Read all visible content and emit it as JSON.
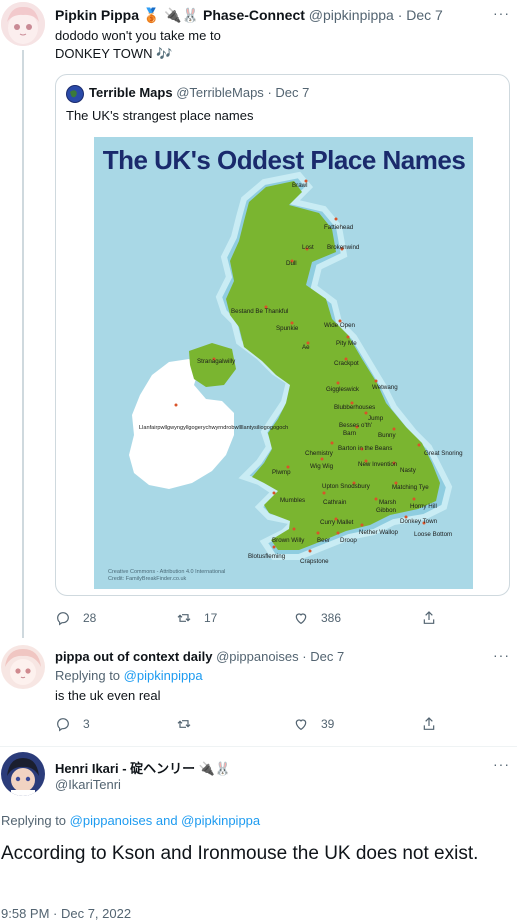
{
  "tweet1": {
    "name": "Pipkin Pippa",
    "name_suffix": "🥉 🔌🐰 Phase-Connect",
    "handle": "@pipkinpippa",
    "date": "· Dec 7",
    "text_line1": "dododo won't you take me to",
    "text_line2": "DONKEY TOWN 🎶",
    "replies": "28",
    "retweets": "17",
    "likes": "386"
  },
  "quote": {
    "name": "Terrible Maps",
    "handle": "@TerribleMaps",
    "date": "· Dec 7",
    "text": "The UK's strangest place names",
    "map_title": "The UK's Oddest Place Names",
    "credit_line1": "Creative Commons - Attribution 4.0 International",
    "credit_line2": "Credit: FamilyBreakFinder.co.uk",
    "places": {
      "brawl": "Brawl",
      "fattiehead": "Fattiehead",
      "lost": "Lost",
      "brokenwind": "Brokenwind",
      "dull": "Dull",
      "bestand": "Bestand Be Thankful",
      "spunkie": "Spunkie",
      "wideopen": "Wide Open",
      "pityme": "Pity Me",
      "ae": "Ae",
      "crackpot": "Crackpot",
      "stranagalwilly": "Stranagalwilly",
      "giggleswick": "Giggleswick",
      "wetwang": "Wetwang",
      "blubberhouses": "Blubberhouses",
      "llan": "Llanfairpwllgwyngyllgogerychwyrndrobwllllantysiliogogogoch",
      "jump": "Jump",
      "besses1": "Besses o'th'",
      "besses2": "Barn",
      "bunny": "Bunny",
      "chemistry": "Chemistry",
      "barton": "Barton in the Beans",
      "greatsnoring": "Great Snoring",
      "wigwig": "Wig Wig",
      "newinvention": "New Invention",
      "nasty": "Nasty",
      "plwmp": "Plwmp",
      "uptonsnodsbury": "Upton Snodsbury",
      "matchingtye": "Matching Tye",
      "mumbles": "Mumbles",
      "cathrain": "Cathrain",
      "marsh": "Marsh",
      "gibbon": "Gibbon",
      "hornyhill": "Horny Hill",
      "donkeytown": "Donkey Town",
      "currymallet": "Curry Mallet",
      "netherwallop": "Nether Wallop",
      "loosebottom": "Loose Bottom",
      "brownwilly": "Brown Willy",
      "beer": "Beer",
      "droop": "Droop",
      "blotusfleming": "Blotusfleming",
      "crapstone": "Crapstone"
    }
  },
  "tweet2": {
    "name": "pippa out of context daily",
    "handle": "@pippanoises",
    "date": "· Dec 7",
    "replying_prefix": "Replying to",
    "replying_to": "@pipkinpippa",
    "text": "is the uk even real",
    "replies": "3",
    "retweets": "",
    "likes": "39"
  },
  "tweet3": {
    "name": "Henri Ikari - 碇ヘンリー 🔌🐰",
    "handle": "@IkariTenri",
    "replying_prefix": "Replying to",
    "replying_to": "@pippanoises and @pipkinpippa",
    "text": "According to Kson and Ironmouse the UK does not exist.",
    "timestamp": "9:58 PM · Dec 7, 2022"
  },
  "more_glyph": "···",
  "colors": {
    "accent": "#1d9bf0",
    "muted": "#536471",
    "sea": "#a9d8e6",
    "land_gb": "#7ab530",
    "land_ie": "#ffffff",
    "map_title": "#1a2a6c"
  }
}
